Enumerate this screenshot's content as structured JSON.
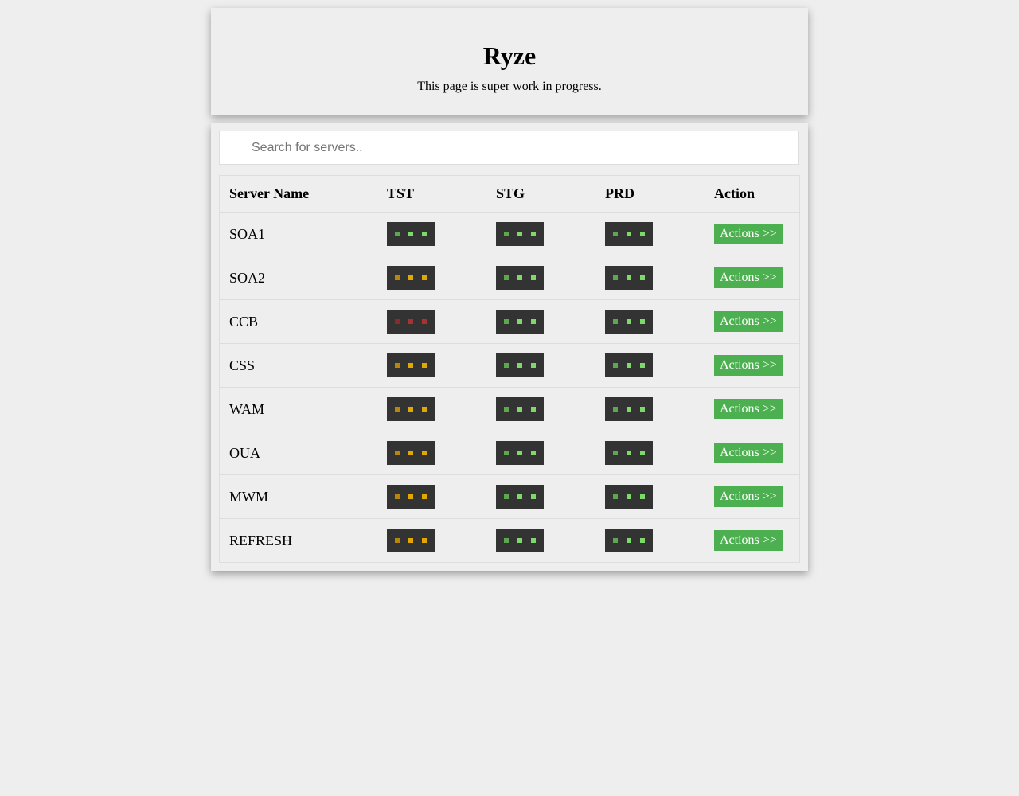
{
  "header": {
    "title": "Ryze",
    "subtitle": "This page is super work in progress."
  },
  "search": {
    "placeholder": "Search for servers..",
    "value": ""
  },
  "table": {
    "columns": [
      "Server Name",
      "TST",
      "STG",
      "PRD",
      "Action"
    ],
    "action_label": "Actions >>",
    "status_colors": {
      "green": [
        "#5da84f",
        "#7ed96b",
        "#7ed96b"
      ],
      "yellow": [
        "#b8860b",
        "#e0a800",
        "#e0a800"
      ],
      "red": [
        "#8b2a2a",
        "#a83232",
        "#a83232"
      ]
    },
    "rows": [
      {
        "name": "SOA1",
        "tst": "green",
        "stg": "green",
        "prd": "green"
      },
      {
        "name": "SOA2",
        "tst": "yellow",
        "stg": "green",
        "prd": "green"
      },
      {
        "name": "CCB",
        "tst": "red",
        "stg": "green",
        "prd": "green"
      },
      {
        "name": "CSS",
        "tst": "yellow",
        "stg": "green",
        "prd": "green"
      },
      {
        "name": "WAM",
        "tst": "yellow",
        "stg": "green",
        "prd": "green"
      },
      {
        "name": "OUA",
        "tst": "yellow",
        "stg": "green",
        "prd": "green"
      },
      {
        "name": "MWM",
        "tst": "yellow",
        "stg": "green",
        "prd": "green"
      },
      {
        "name": "REFRESH",
        "tst": "yellow",
        "stg": "green",
        "prd": "green"
      }
    ]
  }
}
